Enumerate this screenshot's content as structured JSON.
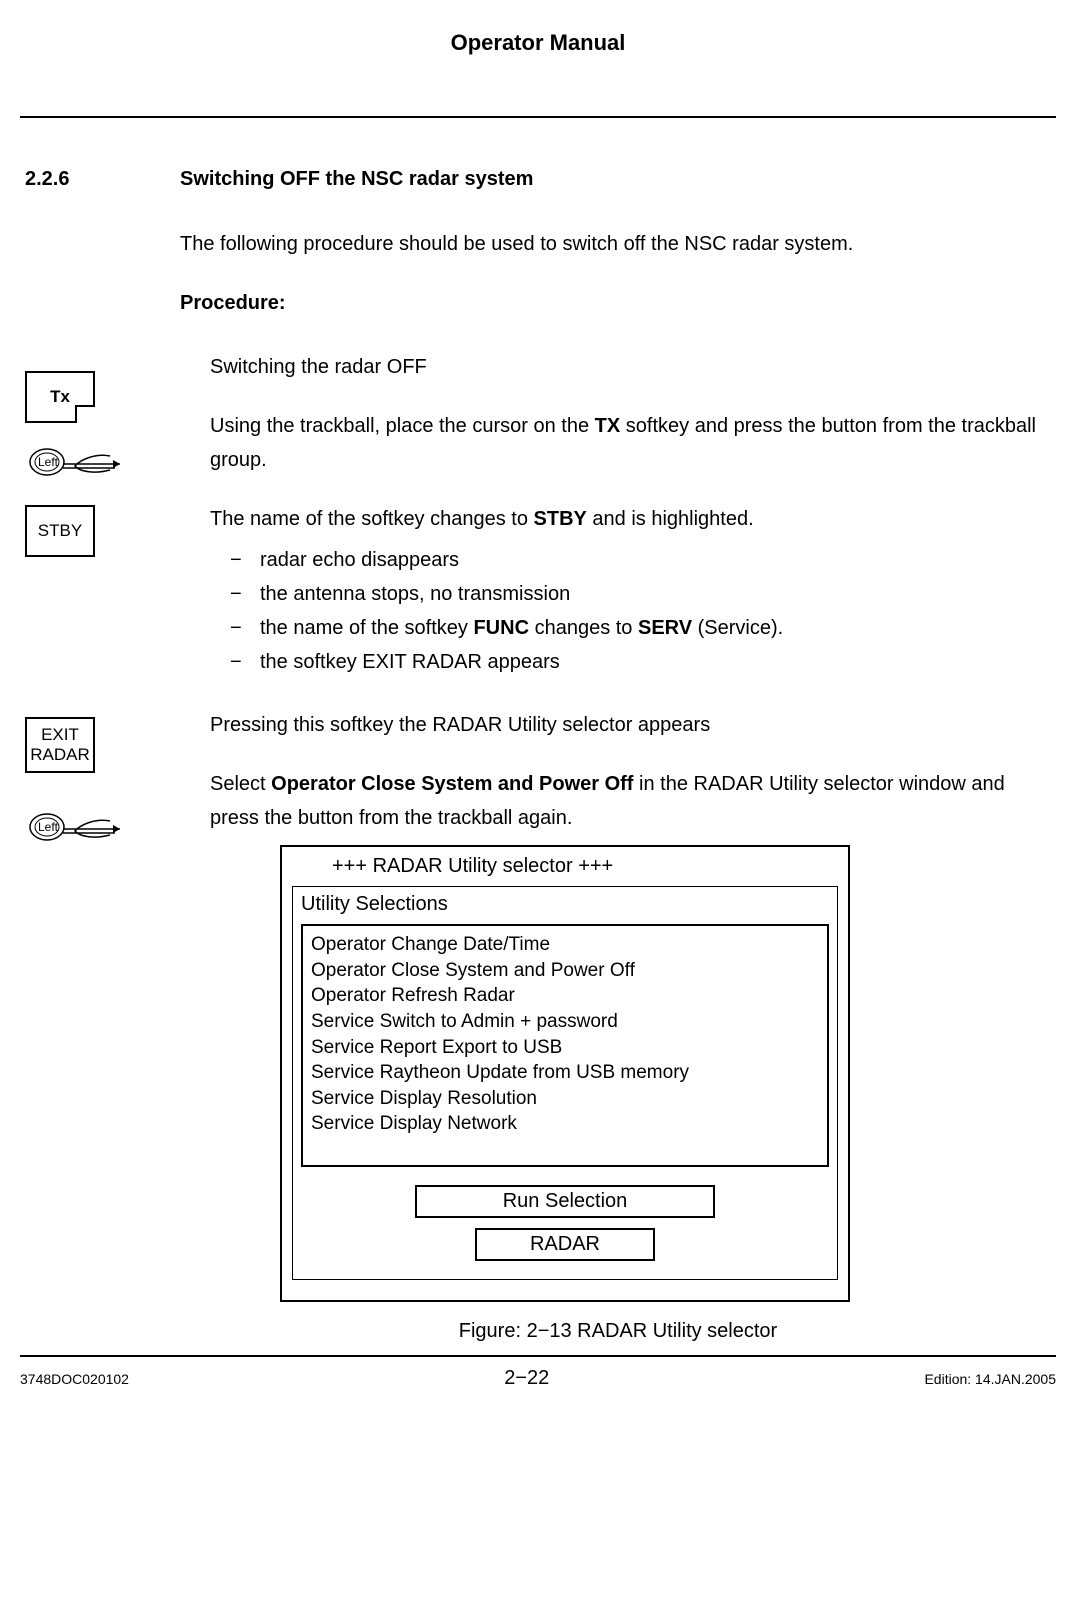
{
  "header": {
    "title": "Operator Manual"
  },
  "section": {
    "number": "2.2.6",
    "title": "Switching OFF the NSC radar system",
    "intro": "The following procedure should be used to switch off the NSC radar system.",
    "procedure_label": "Procedure:"
  },
  "softkeys": {
    "tx": "Tx",
    "stby": "STBY",
    "exit_line1": "EXIT",
    "exit_line2": "RADAR",
    "left_label": "Left"
  },
  "steps": {
    "s1": "Switching the radar OFF",
    "s2a": "Using the trackball, place the cursor on the ",
    "s2b": "TX",
    "s2c": " softkey and press the button from the trackball group.",
    "s3a": "The name of the softkey changes to ",
    "s3b": "STBY",
    "s3c": " and is highlighted.",
    "b1": "radar echo disappears",
    "b2": "the antenna stops, no transmission",
    "b3a": "the name of the softkey ",
    "b3b": "FUNC",
    "b3c": " changes to ",
    "b3d": "SERV",
    "b3e": " (Service).",
    "b4": "the softkey EXIT RADAR  appears",
    "s4": "Pressing this softkey the RADAR Utility selector appears",
    "s5a": "Select ",
    "s5b": "Operator Close System and Power Off",
    "s5c": " in the RADAR Utility selector window and press the button from the trackball again."
  },
  "dialog": {
    "title": "+++ RADAR Utility selector +++",
    "subtitle": "Utility Selections",
    "options": [
      "Operator Change Date/Time",
      "Operator Close  System and Power Off",
      "Operator Refresh Radar",
      "Service Switch to Admin + password",
      "Service Report Export to USB",
      "Service Raytheon Update from USB memory",
      "Service Display Resolution",
      "Service Display Network"
    ],
    "run_btn": "Run Selection",
    "radar_btn": "RADAR"
  },
  "figure": {
    "caption": "Figure: 2−13 RADAR Utility selector"
  },
  "footer": {
    "doc": "3748DOC020102",
    "page": "2−22",
    "edition": "Edition: 14.JAN.2005"
  }
}
